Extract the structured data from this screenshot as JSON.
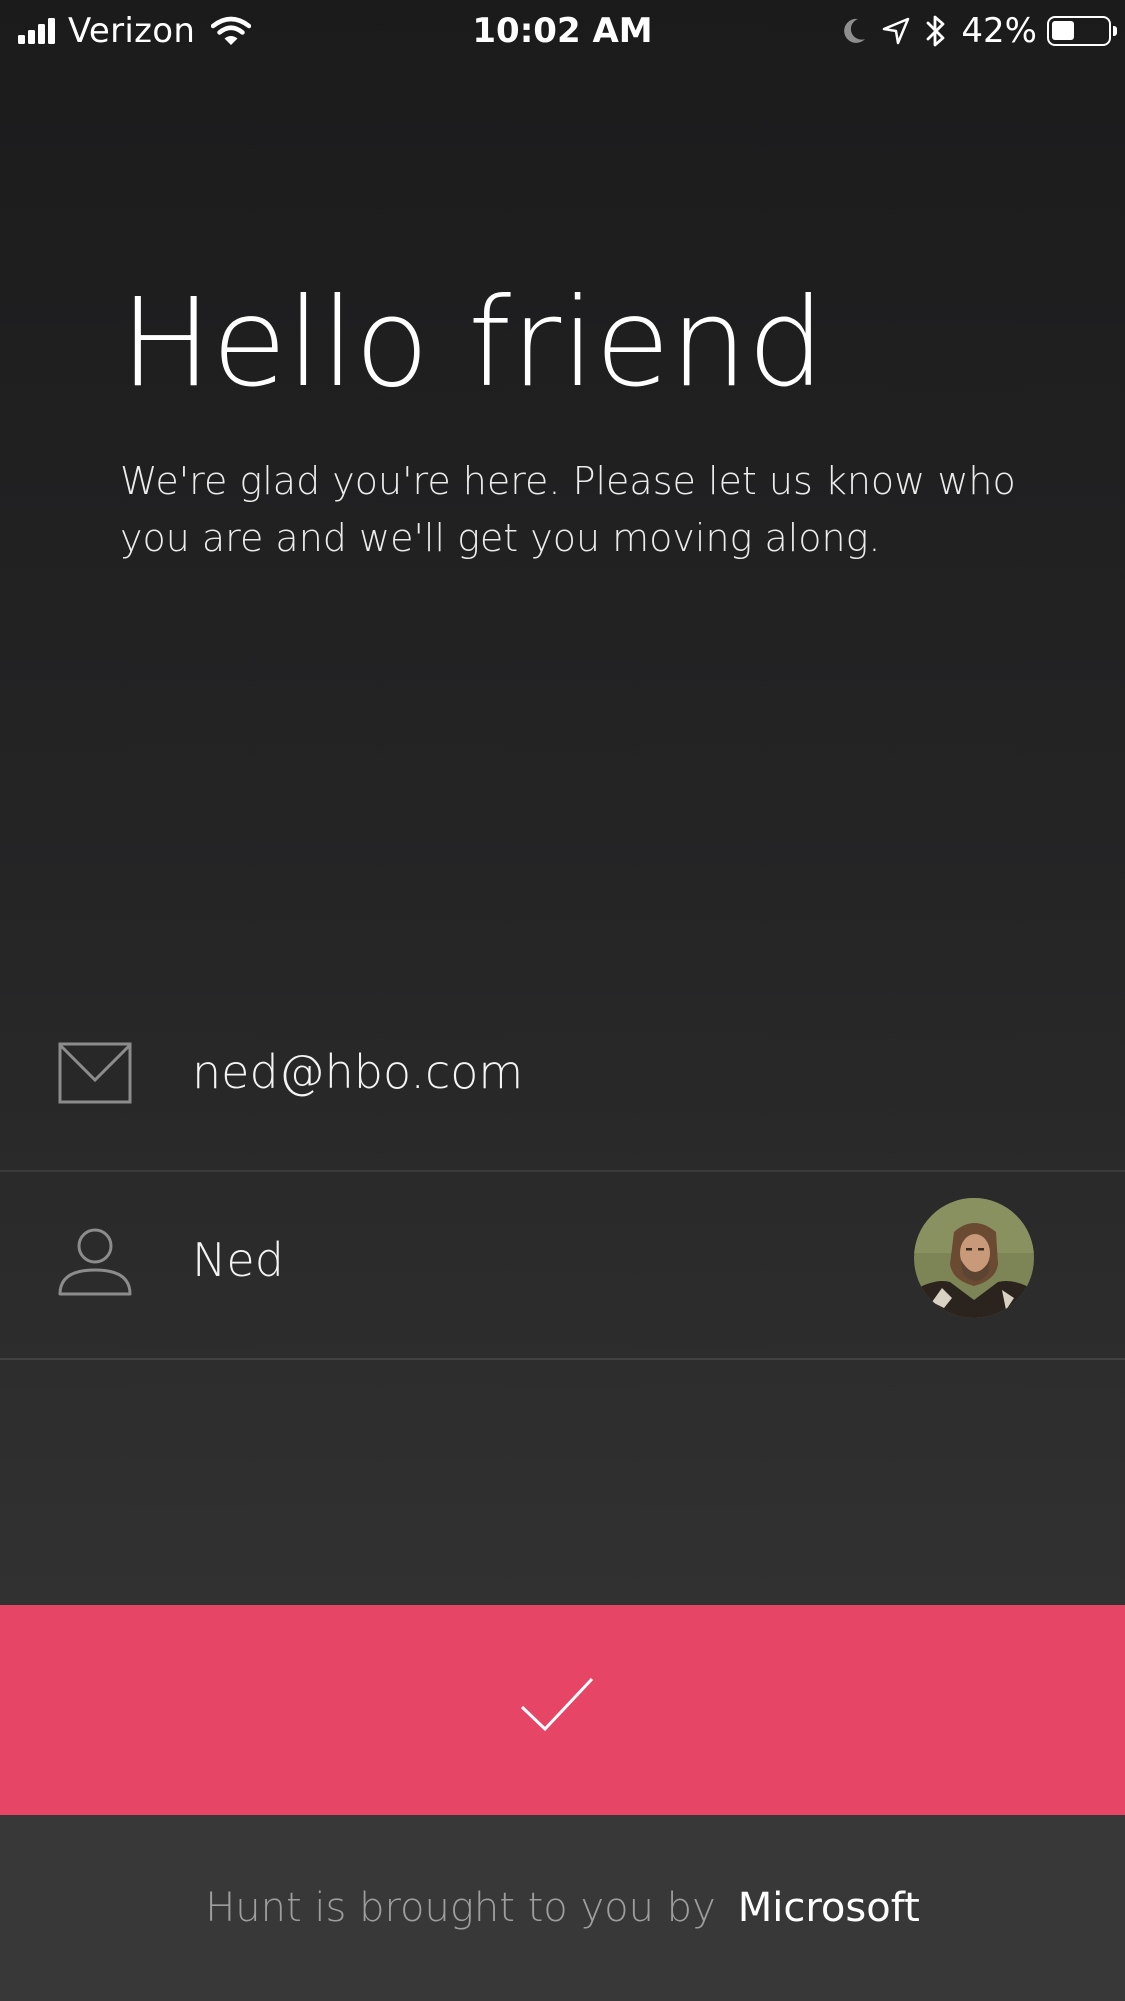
{
  "status_bar": {
    "carrier": "Verizon",
    "time": "10:02 AM",
    "battery_percent": "42%",
    "battery_level": 0.42,
    "icons": [
      "signal-icon",
      "wifi-icon",
      "moon-icon",
      "location-icon",
      "bluetooth-icon",
      "battery-icon"
    ]
  },
  "welcome": {
    "title": "Hello friend",
    "subtitle": "We're glad you're here. Please let us know who you are and we'll get you moving along."
  },
  "form": {
    "email": {
      "value": "ned@hbo.com",
      "icon": "mail-icon"
    },
    "name": {
      "value": "Ned",
      "icon": "person-icon",
      "avatar": "profile-avatar"
    }
  },
  "submit": {
    "icon": "check-icon",
    "color": "#e74566"
  },
  "footer": {
    "text": "Hunt is brought to you by",
    "brand": "Microsoft"
  }
}
